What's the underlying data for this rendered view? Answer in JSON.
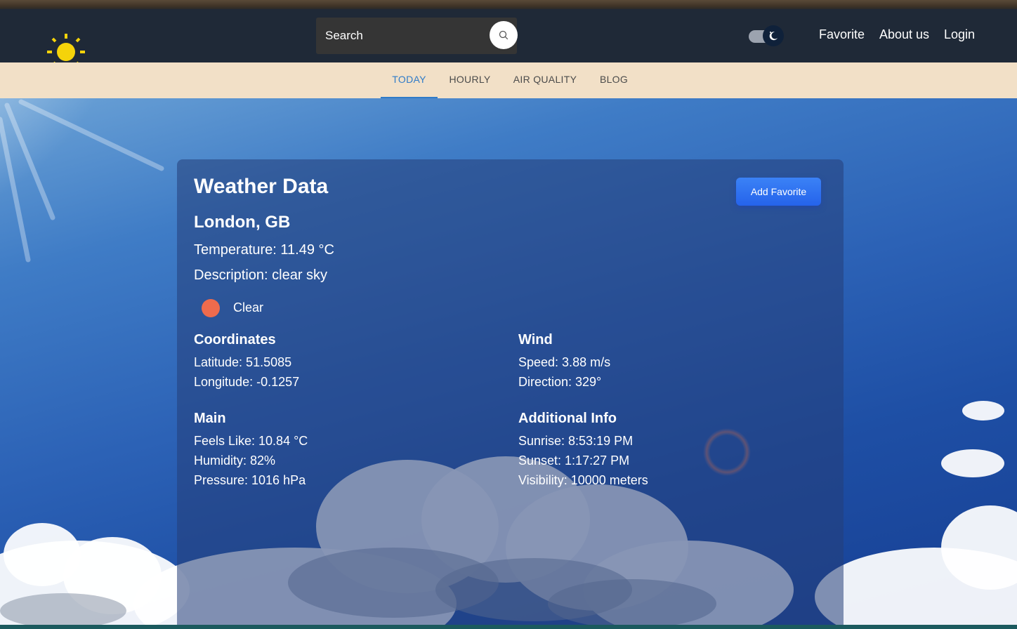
{
  "navbar": {
    "search_placeholder": "Search",
    "links": [
      "Favorite",
      "About us",
      "Login"
    ],
    "colors": {
      "background": "#1f2937",
      "sun": "#f5d30a"
    }
  },
  "tabs": {
    "items": [
      "TODAY",
      "HOURLY",
      "AIR QUALITY",
      "BLOG"
    ],
    "active": "TODAY",
    "colors": {
      "bar": "#f2e0c7",
      "active": "#2f7bc8"
    }
  },
  "weather": {
    "title": "Weather Data",
    "add_favorite_label": "Add Favorite",
    "city": "London, GB",
    "temperature": "Temperature: 11.49 °C",
    "description": "Description: clear sky",
    "condition": "Clear",
    "sections": {
      "coordinates": {
        "title": "Coordinates",
        "lines": [
          "Latitude: 51.5085",
          "Longitude: -0.1257"
        ]
      },
      "wind": {
        "title": "Wind",
        "lines": [
          "Speed: 3.88 m/s",
          "Direction: 329°"
        ]
      },
      "main": {
        "title": "Main",
        "lines": [
          "Feels Like: 10.84 °C",
          "Humidity: 82%",
          "Pressure: 1016 hPa"
        ]
      },
      "additional": {
        "title": "Additional Info",
        "lines": [
          "Sunrise: 8:53:19 PM",
          "Sunset: 1:17:27 PM",
          "Visibility: 10000 meters"
        ]
      }
    },
    "colors": {
      "button": "#2563eb",
      "condition_dot": "#ee6b4d"
    }
  }
}
